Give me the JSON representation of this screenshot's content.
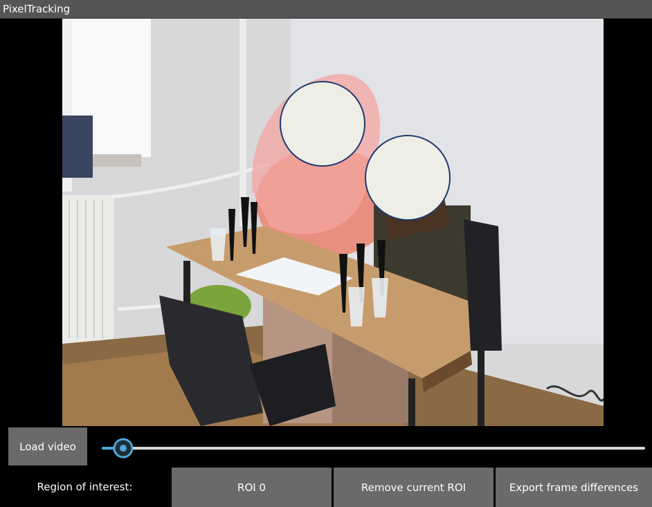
{
  "window": {
    "title": "PixelTracking"
  },
  "video": {
    "description_icon": "video-frame",
    "highlight_color": "#f4a6a0"
  },
  "controls": {
    "load_label": "Load video",
    "slider_value": 0.04,
    "slider_color": "#4aa8d8"
  },
  "bottom": {
    "roi_label": "Region of interest:",
    "roi_current": "ROI 0",
    "remove_label": "Remove current ROI",
    "export_label": "Export frame differences"
  }
}
